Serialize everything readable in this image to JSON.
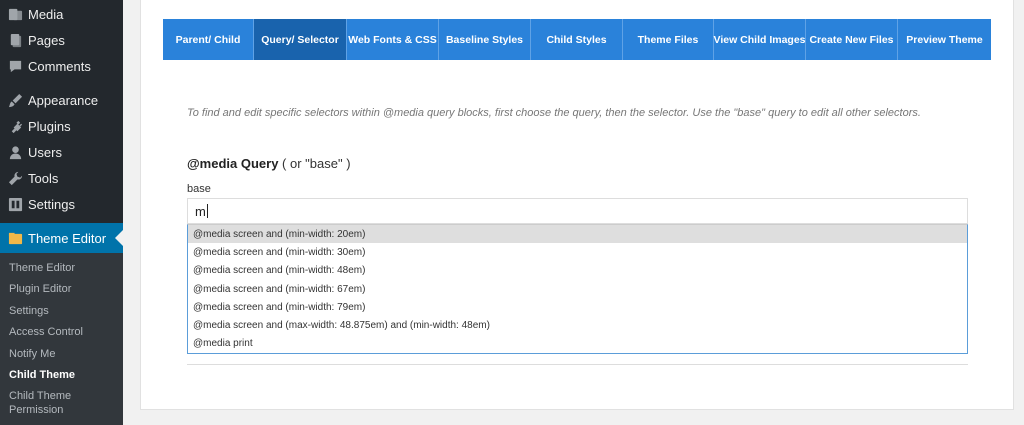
{
  "sidebar": {
    "items": [
      {
        "label": "Media",
        "icon": "media-icon"
      },
      {
        "label": "Pages",
        "icon": "pages-icon"
      },
      {
        "label": "Comments",
        "icon": "comments-icon"
      },
      {
        "label": "Appearance",
        "icon": "appearance-icon"
      },
      {
        "label": "Plugins",
        "icon": "plugins-icon"
      },
      {
        "label": "Users",
        "icon": "users-icon"
      },
      {
        "label": "Tools",
        "icon": "tools-icon"
      },
      {
        "label": "Settings",
        "icon": "settings-icon"
      }
    ],
    "active_item": {
      "label": "Theme Editor",
      "icon": "theme-editor-icon"
    },
    "submenu": [
      {
        "label": "Theme Editor"
      },
      {
        "label": "Plugin Editor"
      },
      {
        "label": "Settings"
      },
      {
        "label": "Access Control"
      },
      {
        "label": "Notify Me"
      },
      {
        "label": "Child Theme",
        "current": true
      },
      {
        "label": "Child Theme Permission"
      }
    ]
  },
  "tabs": [
    {
      "label": "Parent/ Child"
    },
    {
      "label": "Query/ Selector",
      "active": true
    },
    {
      "label": "Web Fonts & CSS"
    },
    {
      "label": "Baseline Styles"
    },
    {
      "label": "Child Styles"
    },
    {
      "label": "Theme Files"
    },
    {
      "label": "View Child Images"
    },
    {
      "label": "Create New Files"
    },
    {
      "label": "Preview Theme"
    }
  ],
  "main": {
    "help_text": "To find and edit specific selectors within @media query blocks, first choose the query, then the selector. Use the \"base\" query to edit all other selectors.",
    "heading_strong": "@media Query",
    "heading_soft": " ( or \"base\" )",
    "current_query": "base",
    "input_value": "m",
    "options": [
      "@media screen and (min-width: 20em)",
      "@media screen and (min-width: 30em)",
      "@media screen and (min-width: 48em)",
      "@media screen and (min-width: 67em)",
      "@media screen and (min-width: 79em)",
      "@media screen and (max-width: 48.875em) and (min-width: 48em)",
      "@media print"
    ],
    "highlighted_option": 0
  },
  "colors": {
    "sidebar_bg": "#23282d",
    "submenu_bg": "#32373c",
    "wp_blue": "#0073aa",
    "tab_bar": "#2a82da",
    "tab_active": "#1963ad"
  }
}
